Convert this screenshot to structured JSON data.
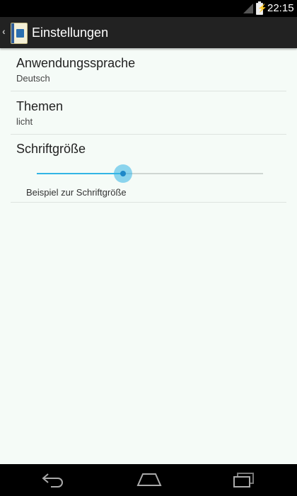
{
  "status_bar": {
    "time": "22:15",
    "icons": [
      "signal-icon",
      "battery-charging-icon"
    ]
  },
  "action_bar": {
    "title": "Einstellungen",
    "icons": [
      "up-navigation-icon",
      "app-icon"
    ]
  },
  "preferences": [
    {
      "title": "Anwendungssprache",
      "summary": "Deutsch"
    },
    {
      "title": "Themen",
      "summary": "licht"
    },
    {
      "title": "Schriftgröße",
      "sample": "Beispiel zur Schriftgröße",
      "slider_value_percent": 38
    }
  ],
  "navigation_bar": {
    "buttons": [
      "back-icon",
      "home-icon",
      "recents-icon"
    ]
  },
  "colors": {
    "accent": "#33b5e5",
    "action_bar": "#222222",
    "background": "#f5fbf7"
  }
}
